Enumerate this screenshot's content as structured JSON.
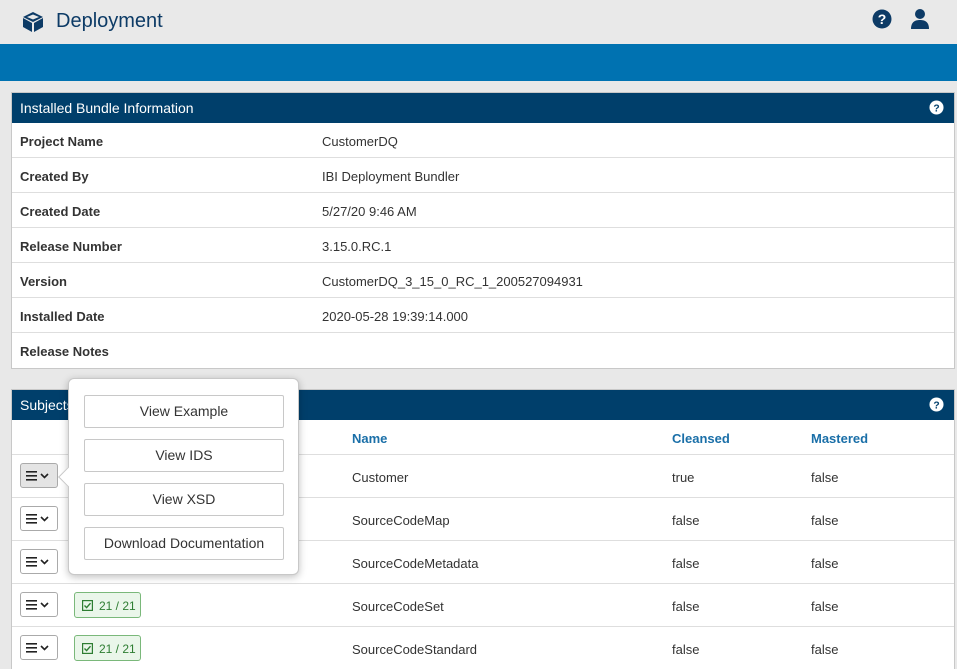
{
  "app": {
    "title": "Deployment"
  },
  "bundle": {
    "title": "Installed Bundle Information",
    "rows": [
      {
        "label": "Project Name",
        "value": "CustomerDQ"
      },
      {
        "label": "Created By",
        "value": "IBI Deployment Bundler"
      },
      {
        "label": "Created Date",
        "value": "5/27/20 9:46 AM"
      },
      {
        "label": "Release Number",
        "value": "3.15.0.RC.1"
      },
      {
        "label": "Version",
        "value": "CustomerDQ_3_15_0_RC_1_200527094931"
      },
      {
        "label": "Installed Date",
        "value": "2020-05-28 19:39:14.000"
      },
      {
        "label": "Release Notes",
        "value": ""
      }
    ]
  },
  "subjects": {
    "title": "Subjects",
    "columns": {
      "name": "Name",
      "cleansed": "Cleansed",
      "mastered": "Mastered"
    },
    "rows": [
      {
        "badge": "",
        "name": "Customer",
        "cleansed": "true",
        "mastered": "false"
      },
      {
        "badge": "",
        "name": "SourceCodeMap",
        "cleansed": "false",
        "mastered": "false"
      },
      {
        "badge": "",
        "name": "SourceCodeMetadata",
        "cleansed": "false",
        "mastered": "false"
      },
      {
        "badge": "21 / 21",
        "name": "SourceCodeSet",
        "cleansed": "false",
        "mastered": "false"
      },
      {
        "badge": "21 / 21",
        "name": "SourceCodeStandard",
        "cleansed": "false",
        "mastered": "false"
      }
    ]
  },
  "popover": {
    "items": [
      "View Example",
      "View IDS",
      "View XSD",
      "Download Documentation"
    ]
  },
  "colors": {
    "header_navy": "#003f6b",
    "band_blue": "#0072b1",
    "title_navy": "#0d3b66",
    "link_blue": "#1a6fa8",
    "badge_green": "#2e7d32"
  },
  "icons": {
    "app": "cube-icon",
    "help": "question-circle-icon",
    "user": "user-icon",
    "menu": "hamburger-menu-icon",
    "badge": "checkbox-checked-icon"
  }
}
